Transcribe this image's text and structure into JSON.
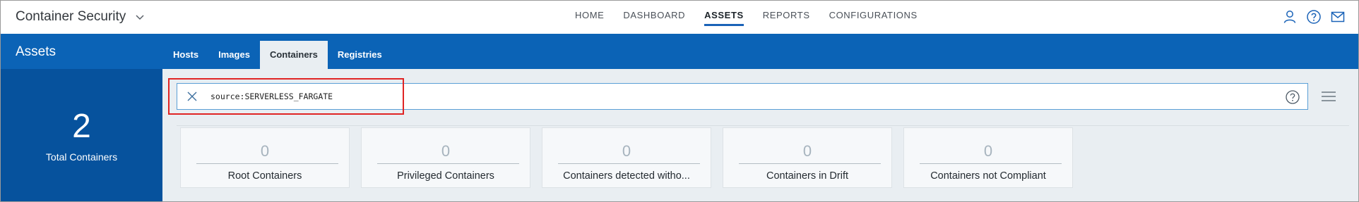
{
  "app": {
    "title": "Container Security"
  },
  "nav": [
    {
      "label": "HOME",
      "active": false
    },
    {
      "label": "DASHBOARD",
      "active": false
    },
    {
      "label": "ASSETS",
      "active": true
    },
    {
      "label": "REPORTS",
      "active": false
    },
    {
      "label": "CONFIGURATIONS",
      "active": false
    }
  ],
  "header": {
    "section_title": "Assets"
  },
  "tabs": [
    {
      "label": "Hosts",
      "active": false
    },
    {
      "label": "Images",
      "active": false
    },
    {
      "label": "Containers",
      "active": true
    },
    {
      "label": "Registries",
      "active": false
    }
  ],
  "summary": {
    "count": "2",
    "label": "Total Containers"
  },
  "search": {
    "query": "source:SERVERLESS_FARGATE"
  },
  "cards": [
    {
      "value": "0",
      "label": "Root Containers"
    },
    {
      "value": "0",
      "label": "Privileged Containers"
    },
    {
      "value": "0",
      "label": "Containers detected witho..."
    },
    {
      "value": "0",
      "label": "Containers in Drift"
    },
    {
      "value": "0",
      "label": "Containers not Compliant"
    }
  ],
  "colors": {
    "accent_blue": "#0b63b6",
    "summary_blue": "#06529d",
    "highlight_red": "#e02424"
  },
  "icons": [
    "chevron-down-icon",
    "user-icon",
    "help-icon",
    "mail-icon",
    "close-icon",
    "menu-icon"
  ]
}
